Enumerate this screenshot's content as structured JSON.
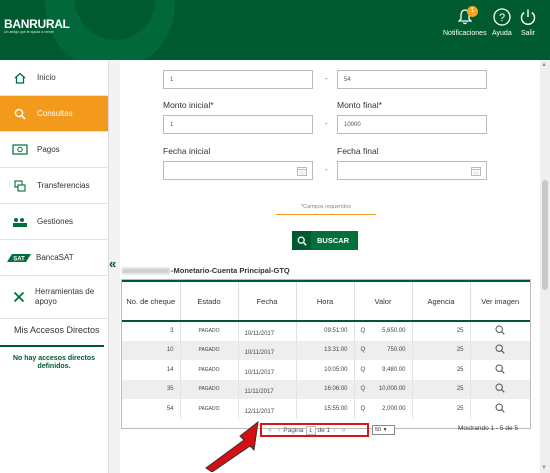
{
  "header": {
    "brand": "BANRURAL",
    "tagline": "Un amigo que te ayuda a crecer",
    "notifications_label": "Notificaciones",
    "notifications_count": "1",
    "help_label": "Ayuda",
    "exit_label": "Salir",
    "colors": {
      "primary": "#005a30",
      "accent": "#f39a1c"
    }
  },
  "sidebar": {
    "items": [
      {
        "label": "Inicio",
        "icon": "home-icon"
      },
      {
        "label": "Consultas",
        "icon": "search-icon",
        "active": true
      },
      {
        "label": "Pagos",
        "icon": "money-icon"
      },
      {
        "label": "Transferencias",
        "icon": "transfer-icon"
      },
      {
        "label": "Gestiones",
        "icon": "gestiones-icon"
      },
      {
        "label": "BancaSAT",
        "icon": "sat-icon"
      },
      {
        "label": "Herramientas de apoyo",
        "icon": "tools-icon"
      }
    ],
    "mis_accesos": "Mis Accesos Directos",
    "no_accesos": "No hay accesos directos definidos."
  },
  "form": {
    "row0_left_value": "1",
    "row0_right_value": "54",
    "monto_inicial_label": "Monto inicial*",
    "monto_inicial_value": "1",
    "monto_final_label": "Monto final*",
    "monto_final_value": "10000",
    "fecha_inicial_label": "Fecha inicial",
    "fecha_final_label": "Fecha final",
    "range_separator": "-",
    "required_note": "*Campos requeridos",
    "search_button": "BUSCAR"
  },
  "account_title": "-Monetario-Cuenta Principal-GTQ",
  "table": {
    "columns": [
      "No. de cheque",
      "Estado",
      "Fecha",
      "Hora",
      "Valor",
      "Agencia",
      "Ver imagen"
    ],
    "rows": [
      {
        "cheque": "3",
        "estado": "PAGADO",
        "fecha": "10/11/2017",
        "hora": "09:51:00",
        "moneda": "Q",
        "valor": "5,650.00",
        "agencia": "25"
      },
      {
        "cheque": "10",
        "estado": "PAGADO",
        "fecha": "10/11/2017",
        "hora": "13:31:00",
        "moneda": "Q",
        "valor": "750.00",
        "agencia": "25"
      },
      {
        "cheque": "14",
        "estado": "PAGADO",
        "fecha": "10/11/2017",
        "hora": "10:05:00",
        "moneda": "Q",
        "valor": "9,480.00",
        "agencia": "25"
      },
      {
        "cheque": "35",
        "estado": "PAGADO",
        "fecha": "11/11/2017",
        "hora": "16:06:00",
        "moneda": "Q",
        "valor": "10,000.00",
        "agencia": "25"
      },
      {
        "cheque": "54",
        "estado": "PAGADO",
        "fecha": "12/11/2017",
        "hora": "15:55:00",
        "moneda": "Q",
        "valor": "2,000.00",
        "agencia": "25"
      }
    ]
  },
  "pager": {
    "page_label": "Página",
    "page_value": "1",
    "of_label": "de 1",
    "per_page": "50",
    "showing": "Mostrando 1 - 5 de 5"
  }
}
